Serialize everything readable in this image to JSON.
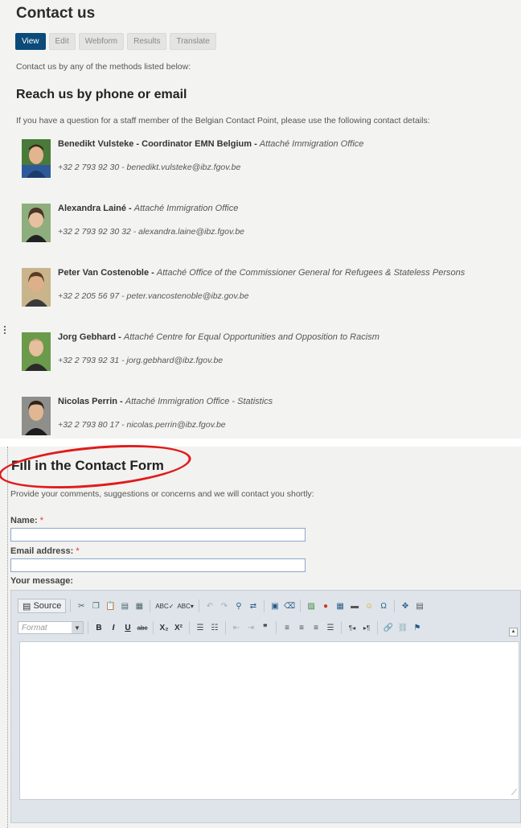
{
  "page": {
    "title": "Contact us",
    "tabs": [
      "View",
      "Edit",
      "Webform",
      "Results",
      "Translate"
    ],
    "intro": "Contact us by any of the methods listed below:",
    "section_title": "Reach us by phone or email",
    "section_desc": "If you have a question for a staff member of the Belgian Contact Point, please use the following contact details:"
  },
  "people": [
    {
      "name": "Benedikt Vulsteke - Coordinator EMN Belgium -",
      "role": "Attaché Immigration Office",
      "contact": "+32 2 793 92 30 - benedikt.vulsteke@ibz.fgov.be"
    },
    {
      "name": "Alexandra Lainé -",
      "role": "Attaché Immigration Office",
      "contact": "+32 2 793 92 30 32 - alexandra.laine@ibz.fgov.be"
    },
    {
      "name": "Peter Van Costenoble -",
      "role": "Attaché Office of the Commissioner General for Refugees & Stateless Persons",
      "contact": "+32 2 205 56 97 - peter.vancostenoble@ibz.gov.be"
    },
    {
      "name": "Jorg Gebhard -",
      "role": "Attaché Centre for Equal Opportunities and Opposition to Racism",
      "contact": "+32 2 793 92 31 - jorg.gebhard@ibz.fgov.be"
    },
    {
      "name": "Nicolas Perrin -",
      "role": "Attaché Immigration Office - Statistics",
      "contact": "+32 2 793 80 17 - nicolas.perrin@ibz.fgov.be"
    }
  ],
  "form": {
    "title": "Fill in the Contact Form",
    "intro": "Provide your comments, suggestions or concerns and we will contact you shortly:",
    "name_label": "Name:",
    "email_label": "Email address:",
    "message_label": "Your message:",
    "required_mark": "*",
    "name_value": "",
    "email_value": ""
  },
  "editor": {
    "source_label": "Source",
    "format_placeholder": "Format",
    "toolbar1": [
      "cut-icon",
      "copy-icon",
      "paste-icon",
      "paste-text-icon",
      "paste-word-icon",
      "|",
      "spellcheck-icon",
      "spellcheck-dropdown-icon",
      "|",
      "undo-icon",
      "redo-icon",
      "find-icon",
      "replace-icon",
      "|",
      "select-all-icon",
      "remove-format-icon",
      "|",
      "image-icon",
      "flash-icon",
      "table-icon",
      "horizontal-rule-icon",
      "smiley-icon",
      "special-char-icon",
      "|",
      "maximize-icon",
      "show-blocks-icon"
    ],
    "toolbar2_glyphs": {
      "bold": "B",
      "italic": "I",
      "underline": "U",
      "strike": "abc",
      "subscript": "X₂",
      "superscript": "X²"
    },
    "accent_color": "#0b4a79",
    "highlight_color": "#e01b1b"
  }
}
